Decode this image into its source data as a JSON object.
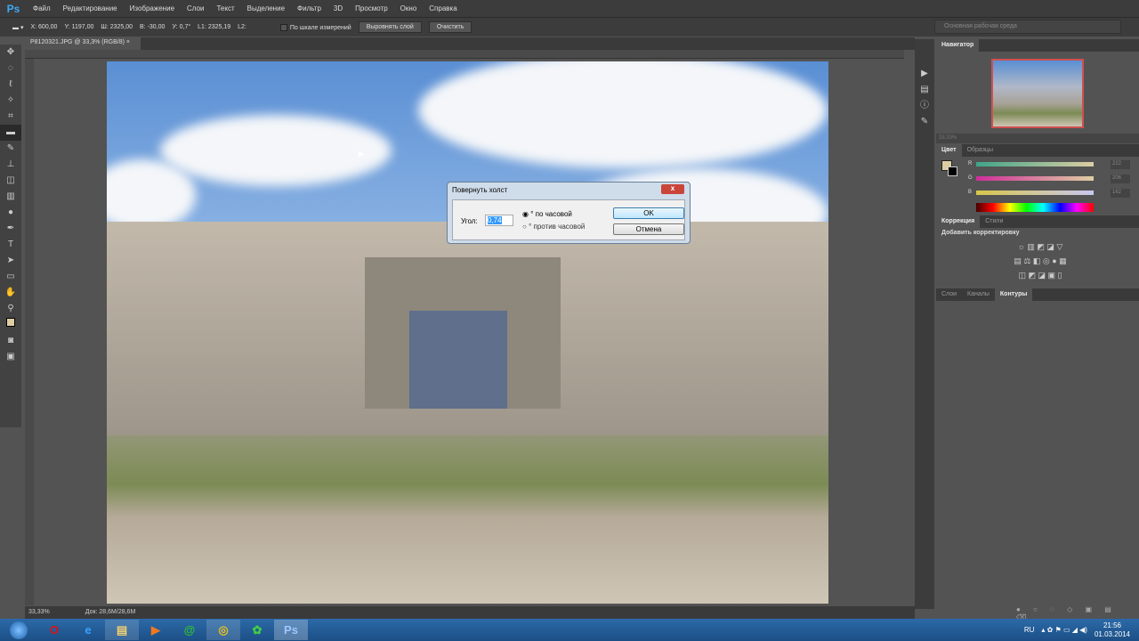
{
  "menubar": {
    "logo": "Ps",
    "items": [
      "Файл",
      "Редактирование",
      "Изображение",
      "Слои",
      "Текст",
      "Выделение",
      "Фильтр",
      "3D",
      "Просмотр",
      "Окно",
      "Справка"
    ]
  },
  "options": {
    "x": "X: 600,00",
    "y": "Y: 1197,00",
    "w": "Ш: 2325,00",
    "h": "В: -30,00",
    "angle": "У: 0,7°",
    "l1": "L1: 2325,19",
    "l2": "L2:",
    "use_scale": "По шкале измерений",
    "straighten": "Выровнять слой",
    "clear": "Очистить",
    "workspace": "Основная рабочая среда"
  },
  "document": {
    "tab": "P8120321.JPG @ 33,3% (RGB/8)",
    "close": "×",
    "zoom": "33,33%",
    "doc_size": "Док: 28,6M/28,6M"
  },
  "panels": {
    "navigator": {
      "title": "Навигатор",
      "zoom": "33,33%"
    },
    "color": {
      "tabs": [
        "Цвет",
        "Образцы"
      ],
      "channels": [
        {
          "label": "R",
          "value": "222"
        },
        {
          "label": "G",
          "value": "206"
        },
        {
          "label": "B",
          "value": "162"
        }
      ],
      "foreground": "#ddcea2"
    },
    "adjustments": {
      "tabs": [
        "Коррекция",
        "Стили"
      ],
      "heading": "Добавить корректировку"
    },
    "layers": {
      "tabs": [
        "Слои",
        "Каналы",
        "Контуры"
      ]
    }
  },
  "dialog": {
    "title": "Повернуть холст",
    "angle_label": "Угол:",
    "angle_value": "0,74",
    "cw": "° по часовой",
    "ccw": "° против часовой",
    "ok": "OK",
    "cancel": "Отмена",
    "close": "x"
  },
  "taskbar": {
    "lang": "RU",
    "time": "21:56",
    "date": "01.03.2014",
    "apps": [
      "O",
      "e",
      "▤",
      "▶",
      "@",
      "◎",
      "✿",
      "Ps"
    ]
  }
}
